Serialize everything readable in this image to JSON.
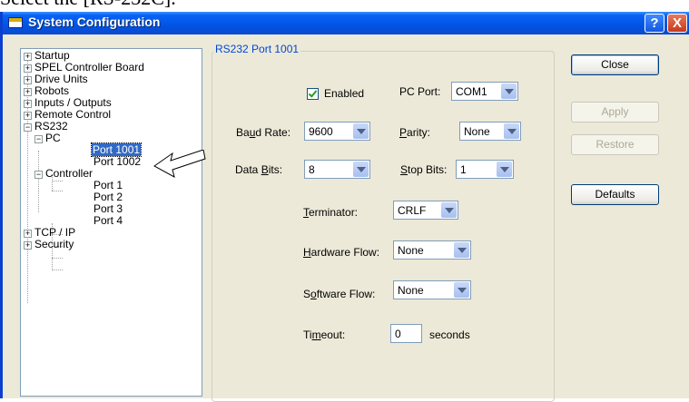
{
  "doc": {
    "caption": "Select the [RS-232C]."
  },
  "window": {
    "title": "System Configuration",
    "help_glyph": "?",
    "close_glyph": "X"
  },
  "tree": {
    "startup": "Startup",
    "spel": "SPEL Controller Board",
    "drive": "Drive Units",
    "robots": "Robots",
    "io": "Inputs / Outputs",
    "remote": "Remote Control",
    "rs232": "RS232",
    "pc": "PC",
    "port1001": "Port 1001",
    "port1002": "Port 1002",
    "controller": "Controller",
    "port1": "Port 1",
    "port2": "Port 2",
    "port3": "Port 3",
    "port4": "Port 4",
    "tcpip": "TCP / IP",
    "security": "Security",
    "plus": "+",
    "minus": "−"
  },
  "panel": {
    "group_title": "RS232 Port 1001",
    "enabled_label": "Enabled",
    "enabled_checked": true,
    "pc_port_label": "PC Port:",
    "pc_port_value": "COM1",
    "baud_label_pre": "Ba",
    "baud_label_u": "u",
    "baud_label_post": "d Rate:",
    "baud_value": "9600",
    "parity_label_u": "P",
    "parity_label_post": "arity:",
    "parity_value": "None",
    "databits_label_pre": "Data ",
    "databits_label_u": "B",
    "databits_label_post": "its:",
    "databits_value": "8",
    "stopbits_label_u": "S",
    "stopbits_label_post": "top Bits:",
    "stopbits_value": "1",
    "terminator_label_u": "T",
    "terminator_label_post": "erminator:",
    "terminator_value": "CRLF",
    "hwflow_label_u": "H",
    "hwflow_label_post": "ardware Flow:",
    "hwflow_value": "None",
    "swflow_label_pre": "S",
    "swflow_label_u": "o",
    "swflow_label_post": "ftware Flow:",
    "swflow_value": "None",
    "timeout_label_pre": "Ti",
    "timeout_label_u": "m",
    "timeout_label_post": "eout:",
    "timeout_value": "0",
    "timeout_unit": "seconds"
  },
  "buttons": {
    "close": "Close",
    "apply": "Apply",
    "restore": "Restore",
    "defaults": "Defaults"
  }
}
